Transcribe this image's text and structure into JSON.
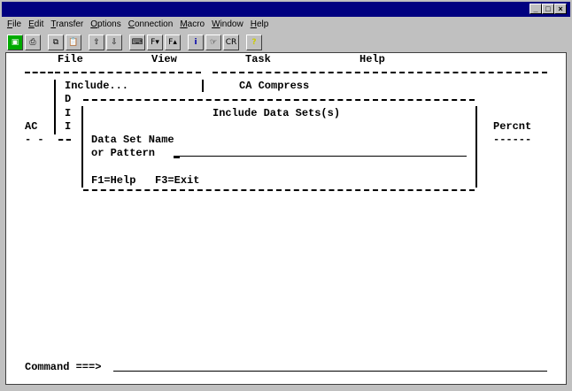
{
  "window": {
    "controls": [
      "minimize",
      "maximize",
      "close"
    ]
  },
  "menu": [
    "File",
    "Edit",
    "Transfer",
    "Options",
    "Connection",
    "Macro",
    "Window",
    "Help"
  ],
  "toolbar": [
    {
      "icon": "display-icon",
      "glyph": "▣"
    },
    {
      "icon": "print-icon",
      "glyph": "⎙"
    },
    {
      "icon": "copy-icon",
      "glyph": "⧉"
    },
    {
      "icon": "paste-icon",
      "glyph": "📋"
    },
    {
      "icon": "send-file-icon",
      "glyph": "⇧"
    },
    {
      "icon": "receive-file-icon",
      "glyph": "⇩"
    },
    {
      "icon": "keyboard-map-icon",
      "glyph": "⌨"
    },
    {
      "icon": "font-down-icon",
      "glyph": "F▾"
    },
    {
      "icon": "font-up-icon",
      "glyph": "F▴"
    },
    {
      "icon": "info-icon",
      "glyph": "i"
    },
    {
      "icon": "macro-icon",
      "glyph": "☞"
    },
    {
      "icon": "clear-icon",
      "glyph": "CR"
    },
    {
      "icon": "help-icon",
      "glyph": "?"
    }
  ],
  "terminal": {
    "action_bar": [
      "File",
      "View",
      "Task",
      "Help"
    ],
    "file_menu": {
      "item1": "Include...",
      "item2": "D",
      "item3": "I",
      "item4": "I"
    },
    "app_title": "CA Compress",
    "col_left": "AC",
    "col_left_sep": "- -",
    "col_right": "Percnt",
    "col_right_sep": "------",
    "popup": {
      "title": "Include Data Sets(s)",
      "label_line1": "Data Set Name",
      "label_line2": "or Pattern",
      "input_value": "",
      "keys": "F1=Help   F3=Exit"
    },
    "command_label": "Command ===>",
    "command_value": ""
  }
}
